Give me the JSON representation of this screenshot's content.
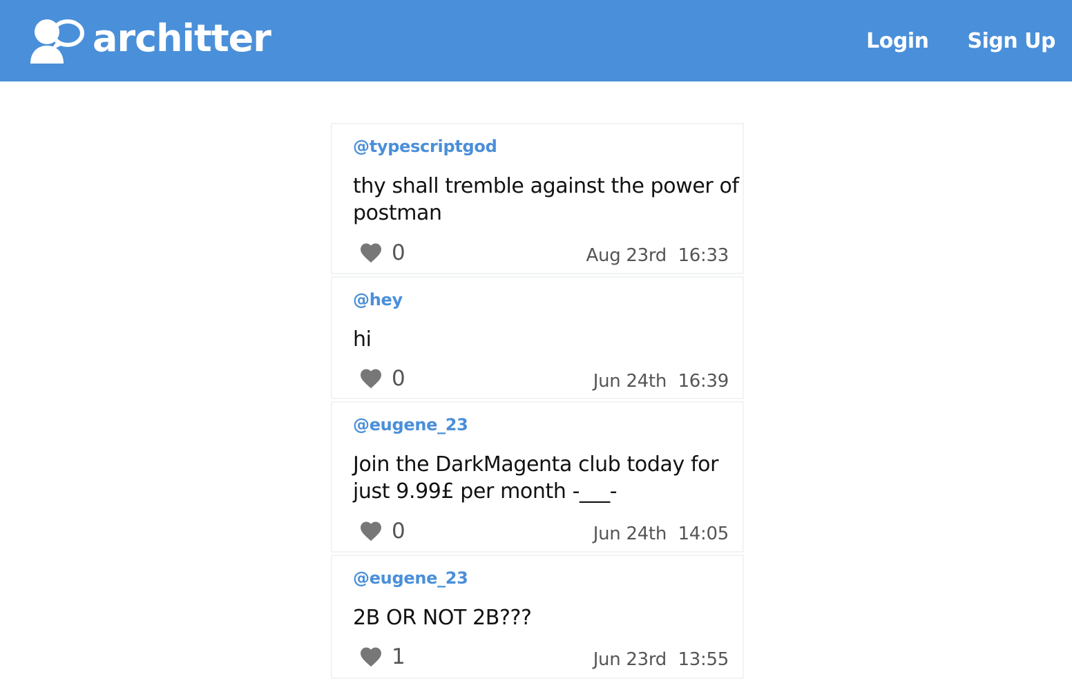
{
  "header": {
    "brand": "architter",
    "logo_icon": "chat-users-icon",
    "login_label": "Login",
    "signup_label": "Sign Up",
    "color": "#4a8fd9"
  },
  "posts": [
    {
      "author": "@typescriptgod",
      "body": "thy shall tremble against the power of postman",
      "likes": "0",
      "date": "Aug 23rd",
      "time": "16:33"
    },
    {
      "author": "@hey",
      "body": "hi",
      "likes": "0",
      "date": "Jun 24th",
      "time": "16:39"
    },
    {
      "author": "@eugene_23",
      "body": "Join the DarkMagenta club today for just 9.99£ per month -___-",
      "likes": "0",
      "date": "Jun 24th",
      "time": "14:05"
    },
    {
      "author": "@eugene_23",
      "body": "2B OR NOT 2B???",
      "likes": "1",
      "date": "Jun 23rd",
      "time": "13:55"
    }
  ]
}
